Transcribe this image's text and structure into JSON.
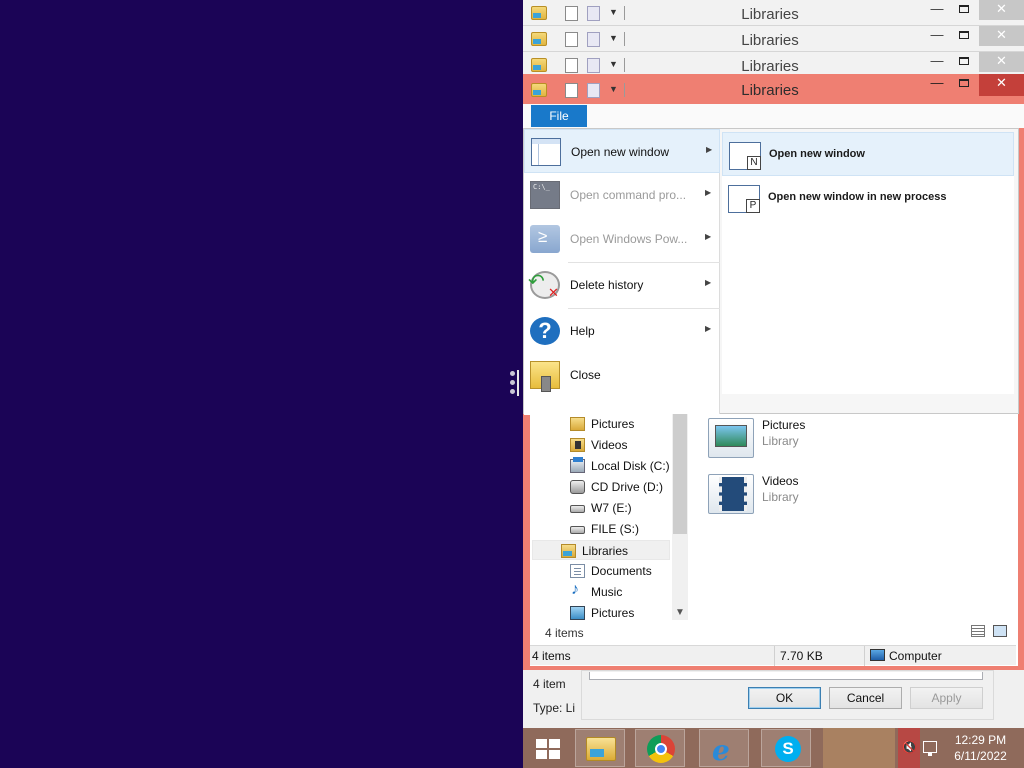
{
  "windows": {
    "title": "Libraries",
    "background_titles": [
      "Libraries",
      "Libraries",
      "Libraries"
    ]
  },
  "ribbon": {
    "file_tab": "File"
  },
  "file_menu": {
    "items": [
      {
        "label": "Open new window",
        "icon": "new-window-icon",
        "enabled": true
      },
      {
        "label": "Open command pro...",
        "icon": "command-prompt-icon",
        "enabled": false
      },
      {
        "label": "Open Windows Pow...",
        "icon": "powershell-icon",
        "enabled": false
      },
      {
        "label": "Delete history",
        "icon": "delete-history-icon",
        "enabled": true
      },
      {
        "label": "Help",
        "icon": "help-icon",
        "enabled": true
      },
      {
        "label": "Close",
        "icon": "close-door-icon",
        "enabled": true
      }
    ],
    "submenu": [
      {
        "label": "Open new window",
        "badge": "N"
      },
      {
        "label": "Open new window in new process",
        "badge": "P"
      }
    ]
  },
  "nav_tree": {
    "items": [
      {
        "label": "Pictures",
        "icon": "pictures-folder-icon"
      },
      {
        "label": "Videos",
        "icon": "videos-folder-icon"
      },
      {
        "label": "Local Disk (C:)",
        "icon": "local-disk-icon"
      },
      {
        "label": "CD Drive (D:)",
        "icon": "cd-drive-icon"
      },
      {
        "label": "W7 (E:)",
        "icon": "drive-icon"
      },
      {
        "label": "FILE (S:)",
        "icon": "drive-icon"
      },
      {
        "label": "Libraries",
        "icon": "libraries-icon"
      },
      {
        "label": "Documents",
        "icon": "documents-icon"
      },
      {
        "label": "Music",
        "icon": "music-icon"
      },
      {
        "label": "Pictures",
        "icon": "pictures-icon"
      }
    ]
  },
  "content": {
    "items": [
      {
        "name": "Pictures",
        "type": "Library"
      },
      {
        "name": "Videos",
        "type": "Library"
      }
    ],
    "item_count": "4 items"
  },
  "statusbar": {
    "count": "4 items",
    "size": "7.70 KB",
    "location": "Computer"
  },
  "dialog": {
    "partial_count": "4 item",
    "partial_type": "Type: Li",
    "ok": "OK",
    "cancel": "Cancel",
    "apply": "Apply"
  },
  "taskbar": {
    "pinned": [
      "file-explorer",
      "chrome",
      "internet-explorer",
      "skype"
    ],
    "time": "12:29 PM",
    "date": "6/11/2022"
  },
  "colors": {
    "desktop": "#1b0456",
    "active_frame": "#ef7f72",
    "file_tab": "#1979ca",
    "taskbar": "#8f6a5b"
  }
}
